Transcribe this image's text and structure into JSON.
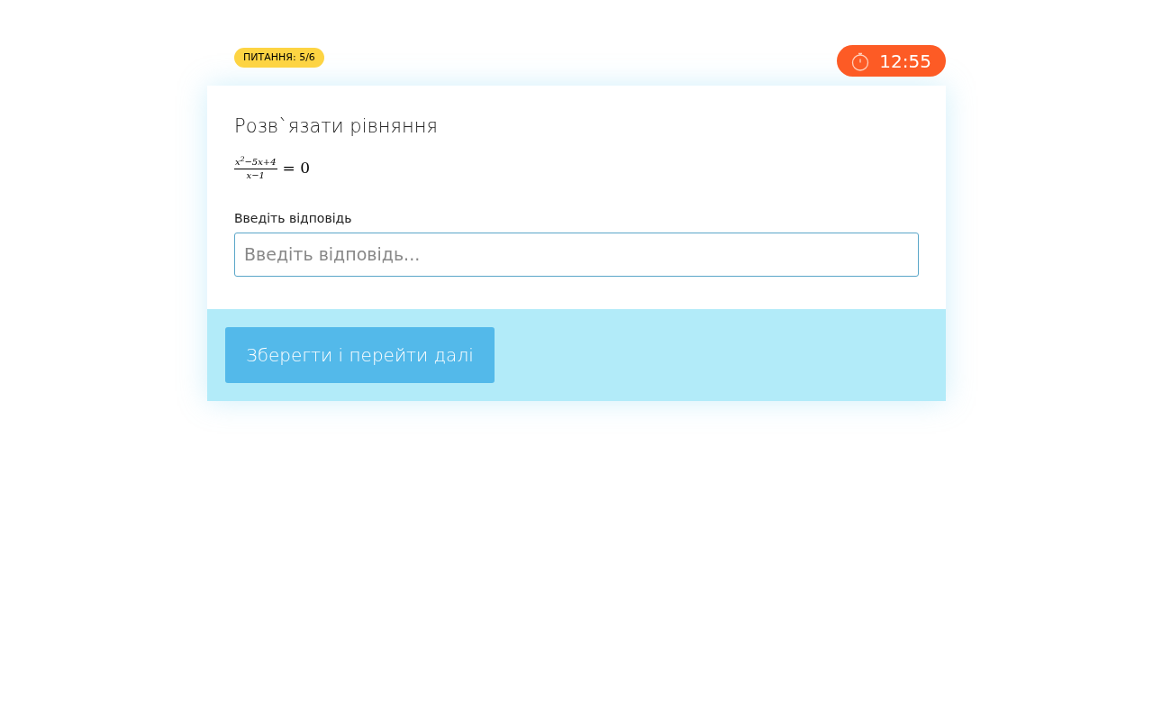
{
  "question_badge": "ПИТАННЯ: 5/6",
  "timer": "12:55",
  "question": {
    "title": "Розв`язати рівняння",
    "formula": {
      "numerator": "x$^{2}$−5x+4",
      "denominator": "x−1",
      "rhs": "= 0"
    }
  },
  "answer": {
    "label": "Введіть відповідь",
    "placeholder": "Введіть відповідь..."
  },
  "submit_button": "Зберегти і перейти далі"
}
